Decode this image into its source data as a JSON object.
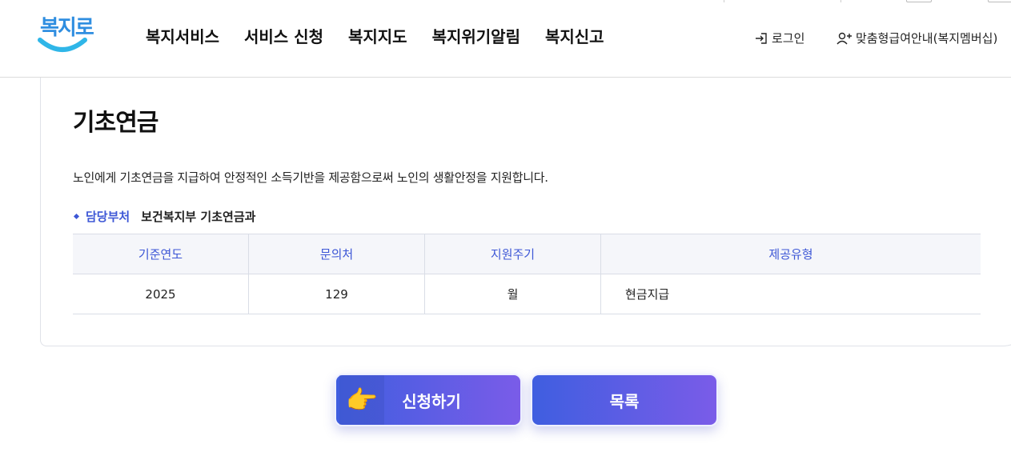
{
  "header": {
    "logo_text": "복지로",
    "nav": [
      "복지서비스",
      "서비스 신청",
      "복지지도",
      "복지위기알림",
      "복지신고"
    ],
    "login_label": "로그인",
    "membership_label": "맞춤형급여안내(복지멤버십)"
  },
  "service": {
    "title": "기초연금",
    "description": "노인에게 기초연금을 지급하여 안정적인 소득기반을 제공함으로써 노인의 생활안정을 지원합니다.",
    "department_label": "담당부처",
    "department_value": "보건복지부 기초연금과"
  },
  "table": {
    "headers": [
      "기준연도",
      "문의처",
      "지원주기",
      "제공유형"
    ],
    "row": [
      "2025",
      "129",
      "월",
      "현금지급"
    ]
  },
  "buttons": {
    "apply_label": "신청하기",
    "list_label": "목록",
    "pointer_emoji": "👉"
  },
  "colors": {
    "accent": "#3d57d6",
    "button_gradient_start": "#3f5ee0",
    "button_gradient_end": "#7a5ce8",
    "logo": "#2f8ee0"
  }
}
